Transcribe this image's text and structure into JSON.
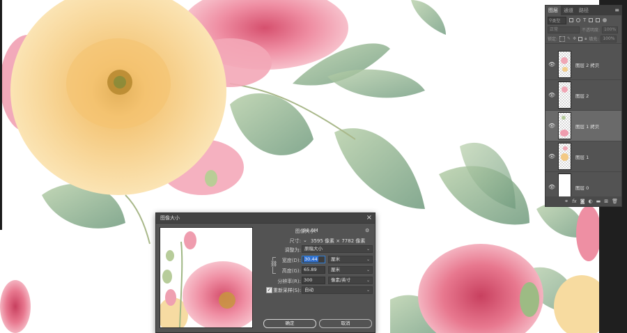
{
  "layers_panel": {
    "tabs": [
      "图层",
      "通道",
      "路径"
    ],
    "active_tab": 0,
    "menu_icon": "hamburger-icon",
    "filter_placeholder": "类型",
    "blend_mode": "正常",
    "opacity_label": "不透明度:",
    "opacity_value": "100%",
    "lock_label": "锁定:",
    "fill_label": "填充:",
    "fill_value": "100%",
    "layers": [
      {
        "name": "图层 2 拷贝",
        "visible": true,
        "selected": false
      },
      {
        "name": "图层 2",
        "visible": true,
        "selected": false
      },
      {
        "name": "图层 1 拷贝",
        "visible": true,
        "selected": true
      },
      {
        "name": "图层 1",
        "visible": true,
        "selected": false
      },
      {
        "name": "图层 0",
        "visible": true,
        "selected": false
      }
    ],
    "footer_icons": [
      "link-icon",
      "fx-icon",
      "mask-icon",
      "adjustment-icon",
      "group-icon",
      "new-layer-icon",
      "delete-icon"
    ]
  },
  "dialog": {
    "title": "图像大小",
    "image_size_label": "图像大小:",
    "image_size_value": "80.0M",
    "dimensions_label": "尺寸:",
    "dimensions_value": "3595 像素 × 7782 像素",
    "fit_to_label": "调整为:",
    "fit_to_value": "原稿大小",
    "width_label": "宽度(D):",
    "width_value": "30.44",
    "width_unit": "厘米",
    "height_label": "高度(G):",
    "height_value": "65.89",
    "height_unit": "厘米",
    "resolution_label": "分辨率(R):",
    "resolution_value": "300",
    "resolution_unit": "像素/英寸",
    "resample_label": "重新采样(S):",
    "resample_checked": true,
    "resample_value": "自动",
    "ok_label": "确定",
    "cancel_label": "取消"
  },
  "colors": {
    "panel_bg": "#535353",
    "dialog_bg": "#535353",
    "selection_blue": "#2f6fd0",
    "peony_pink": "#e9869a",
    "peony_yellow": "#f5c97c",
    "leaf_green": "#8fb08a"
  }
}
